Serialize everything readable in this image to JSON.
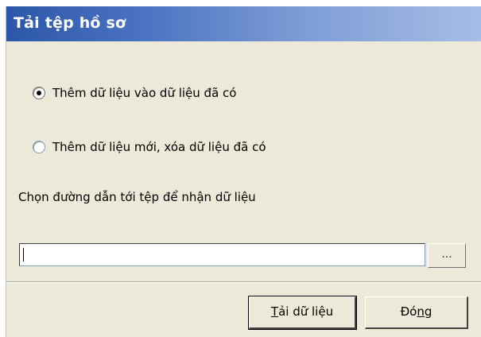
{
  "window": {
    "title": "Tải tệp hồ sơ"
  },
  "options": [
    {
      "label": "Thêm dữ liệu vào dữ liệu đã có",
      "selected": true
    },
    {
      "label": "Thêm dữ liệu mới, xóa dữ liệu đã có",
      "selected": false
    }
  ],
  "path": {
    "prompt": "Chọn đường dẫn tới tệp để nhận dữ liệu",
    "value": "",
    "browse_label": "..."
  },
  "buttons": {
    "load": {
      "mnemonic": "T",
      "rest": "ải dữ liệu"
    },
    "close": {
      "prefix": "Đó",
      "mnemonic": "n",
      "suffix": "g"
    }
  },
  "colors": {
    "title_start": "#2c56a8",
    "title_end": "#a6bde6",
    "dialog_bg": "#ece9d8"
  }
}
